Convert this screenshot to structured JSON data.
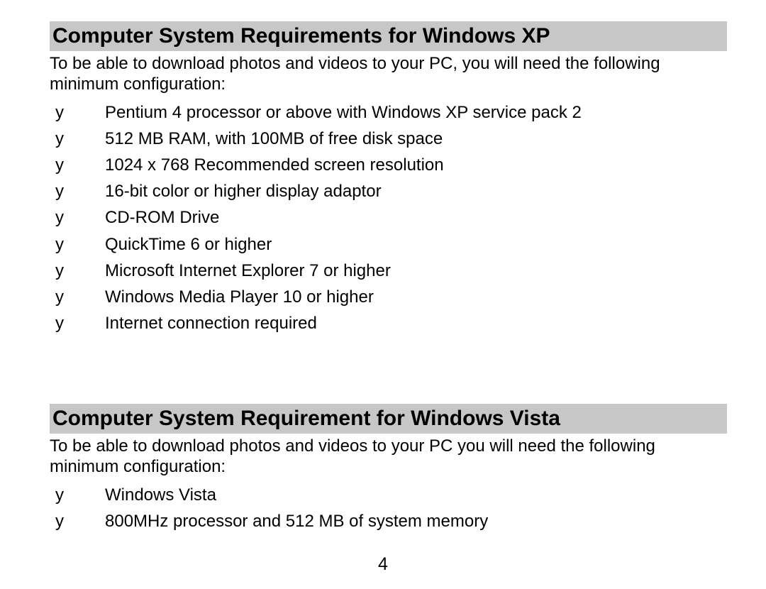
{
  "sections": [
    {
      "heading": "Computer System Requirements for Windows XP",
      "intro": "To be able to download photos and videos to your PC, you will need the following minimum configuration:",
      "bullet_char": "y",
      "items": [
        "Pentium 4 processor or above with Windows XP service pack 2",
        "512 MB RAM, with 100MB of free disk space",
        "1024 x 768 Recommended screen resolution",
        "16-bit color or higher display adaptor",
        "CD-ROM Drive",
        "QuickTime 6 or higher",
        "Microsoft Internet Explorer 7 or higher",
        "Windows Media Player 10 or higher",
        "Internet connection required"
      ]
    },
    {
      "heading": "Computer System Requirement for Windows Vista",
      "intro": "To be able to download photos and videos to your PC you will need the following minimum configuration:",
      "bullet_char": "y",
      "items": [
        "Windows Vista",
        "800MHz processor and 512 MB of system memory"
      ]
    }
  ],
  "page_number": "4"
}
